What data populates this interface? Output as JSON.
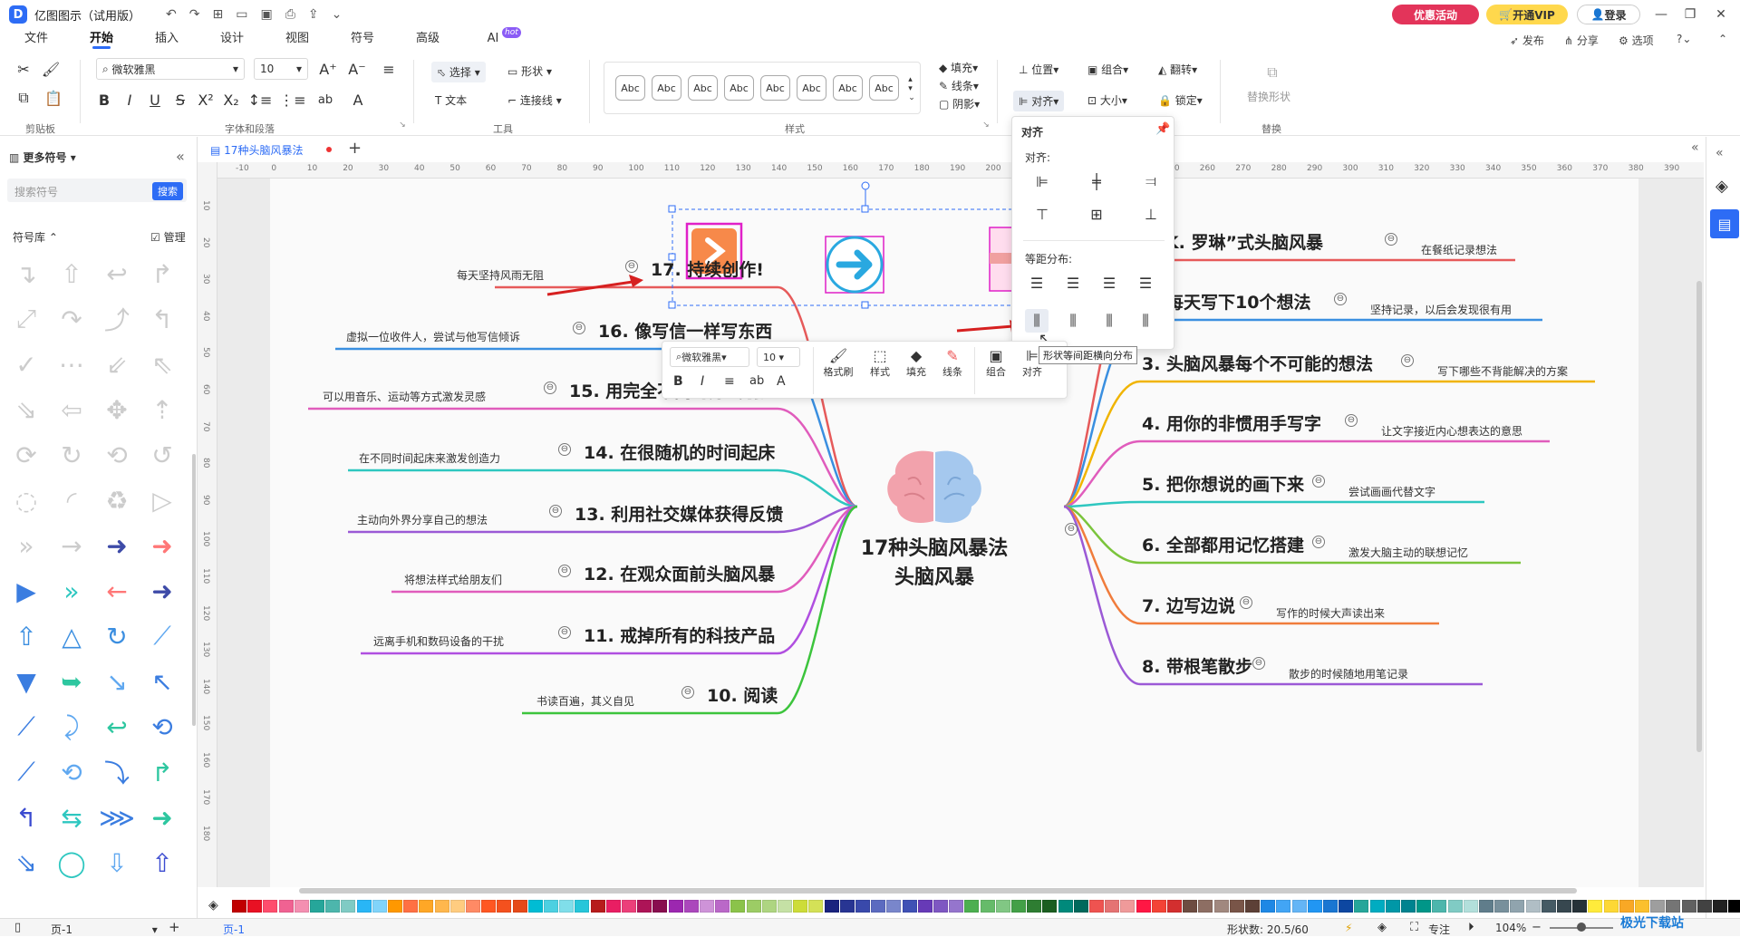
{
  "app": {
    "title": "亿图图示（试用版）",
    "promo": "优惠活动",
    "vip": "开通VIP",
    "login": "登录"
  },
  "menu": {
    "items": [
      "文件",
      "开始",
      "插入",
      "设计",
      "视图",
      "符号",
      "高级",
      "AI"
    ],
    "active": "开始",
    "hot": "hot",
    "right": [
      "发布",
      "分享",
      "选项"
    ]
  },
  "ribbon": {
    "font_name": "微软雅黑",
    "font_size": "10",
    "groups": {
      "clipboard": "剪贴板",
      "font": "字体和段落",
      "tools": "工具",
      "style": "样式",
      "replace": "替换"
    },
    "select": "选择",
    "shape": "形状",
    "text": "文本",
    "connector": "连接线",
    "abc": [
      "Abc",
      "Abc",
      "Abc",
      "Abc",
      "Abc",
      "Abc",
      "Abc",
      "Abc"
    ],
    "fill": "填充",
    "line": "线条",
    "shadow": "阴影",
    "position": "位置",
    "group": "组合",
    "flip": "翻转",
    "align": "对齐",
    "size": "大小",
    "lock": "锁定",
    "replace_shape": "替换形状"
  },
  "left": {
    "title": "更多符号",
    "search_placeholder": "搜索符号",
    "search_btn": "搜索",
    "lib": "符号库",
    "manage": "管理"
  },
  "tab": {
    "name": "17种头脑风暴法"
  },
  "ruler": {
    "h": [
      "-10",
      "0",
      "10",
      "20",
      "30",
      "40",
      "50",
      "60",
      "70",
      "80",
      "90",
      "100",
      "110",
      "120",
      "130",
      "140",
      "150",
      "160",
      "170",
      "180",
      "190",
      "200",
      "210",
      "220",
      "230",
      "240",
      "250",
      "260",
      "270",
      "280",
      "290",
      "300",
      "310",
      "320",
      "330",
      "340",
      "350",
      "360",
      "370",
      "380",
      "390"
    ],
    "v": [
      "10",
      "20",
      "30",
      "40",
      "50",
      "60",
      "70",
      "80",
      "90",
      "100",
      "110",
      "120",
      "130",
      "140",
      "150",
      "160",
      "170",
      "180"
    ]
  },
  "mindmap": {
    "center": [
      "17种头脑风暴法",
      "头脑风暴"
    ],
    "right": [
      {
        "title": "“J.K. 罗琳”式头脑风暴",
        "note": "在餐纸记录想法"
      },
      {
        "title": "2. 每天写下10个想法",
        "note": "坚持记录，以后会发现很有用"
      },
      {
        "title": "3. 头脑风暴每个不可能的想法",
        "note": "写下哪些不背能解决的方案"
      },
      {
        "title": "4. 用你的非惯用手写字",
        "note": "让文字接近内心想表达的意思"
      },
      {
        "title": "5. 把你想说的画下来",
        "note": "尝试画画代替文字"
      },
      {
        "title": "6. 全部都用记忆搭建",
        "note": "激发大脑主动的联想记忆"
      },
      {
        "title": "7. 边写边说",
        "note": "写作的时候大声读出来"
      },
      {
        "title": "8. 带根笔散步",
        "note": "散步的时候随地用笔记录"
      }
    ],
    "left": [
      {
        "title": "17. 持续创作!",
        "note": "每天坚持风雨无阻"
      },
      {
        "title": "16. 像写信一样写东西",
        "note": "虚拟一位收件人，尝试与他写信倾诉"
      },
      {
        "title": "15. 用完全不同的方式创造",
        "note": "可以用音乐、运动等方式激发灵感"
      },
      {
        "title": "14. 在很随机的时间起床",
        "note": "在不同时间起床来激发创造力"
      },
      {
        "title": "13. 利用社交媒体获得反馈",
        "note": "主动向外界分享自己的想法"
      },
      {
        "title": "12. 在观众面前头脑风暴",
        "note": "将想法样式给朋友们"
      },
      {
        "title": "11. 戒掉所有的科技产品",
        "note": "远离手机和数码设备的干扰"
      },
      {
        "title": "10. 阅读",
        "note": "书读百遍，其义自见"
      }
    ],
    "collapse": "⊖"
  },
  "align_popup": {
    "title": "对齐",
    "section1": "对齐:",
    "section2": "等距分布:",
    "tooltip": "形状等间距横向分布"
  },
  "floatbar": {
    "font": "微软雅黑",
    "size": "10",
    "items": [
      "格式刷",
      "样式",
      "填充",
      "线条",
      "组合",
      "对齐"
    ]
  },
  "status": {
    "page": "页-1",
    "page_tab": "页-1",
    "shape_count": "形状数: 20.5/60",
    "focus": "专注",
    "zoom": "104%",
    "watermark": "极光下载站"
  },
  "colors": {
    "accent": "#2d6cf5",
    "selection": "#e020c8",
    "arrow": "#d62020"
  },
  "palette": [
    "#c00000",
    "#e81123",
    "#ff4d6d",
    "#f06292",
    "#f48fb1",
    "#26a69a",
    "#4db6ac",
    "#80cbc4",
    "#29b6f6",
    "#81d4fa",
    "#ff9800",
    "#ff7043",
    "#ffa726",
    "#ffb74d",
    "#ffcc80",
    "#ff8a65",
    "#ff5722",
    "#f4511e",
    "#e64a19",
    "#00bcd4",
    "#4dd0e1",
    "#80deea",
    "#26c6da",
    "#b71c1c",
    "#e91e63",
    "#ec407a",
    "#ad1457",
    "#880e4f",
    "#9c27b0",
    "#ab47bc",
    "#ce93d8",
    "#ba68c8",
    "#8bc34a",
    "#9ccc65",
    "#aed581",
    "#c5e1a5",
    "#cddc39",
    "#d4e157",
    "#1a237e",
    "#283593",
    "#3949ab",
    "#5c6bc0",
    "#7986cb",
    "#3f51b5",
    "#673ab7",
    "#7e57c2",
    "#9575cd",
    "#4caf50",
    "#66bb6a",
    "#81c784",
    "#43a047",
    "#2e7d32",
    "#1b5e20",
    "#00897b",
    "#00695c",
    "#ef5350",
    "#e57373",
    "#ef9a9a",
    "#ff1744",
    "#f44336",
    "#d32f2f",
    "#6d4c41",
    "#8d6e63",
    "#a1887f",
    "#795548",
    "#5d4037",
    "#1e88e5",
    "#42a5f5",
    "#64b5f6",
    "#2196f3",
    "#1976d2",
    "#0d47a1",
    "#26a69a",
    "#00acc1",
    "#0097a7",
    "#00838f",
    "#009688",
    "#4db6ac",
    "#80cbc4",
    "#b2dfdb",
    "#607d8b",
    "#78909c",
    "#90a4ae",
    "#b0bec5",
    "#455a64",
    "#37474f",
    "#263238",
    "#ffeb3b",
    "#fdd835",
    "#f9a825",
    "#fbc02d",
    "#9e9e9e",
    "#757575",
    "#616161",
    "#424242",
    "#212121",
    "#000000"
  ]
}
